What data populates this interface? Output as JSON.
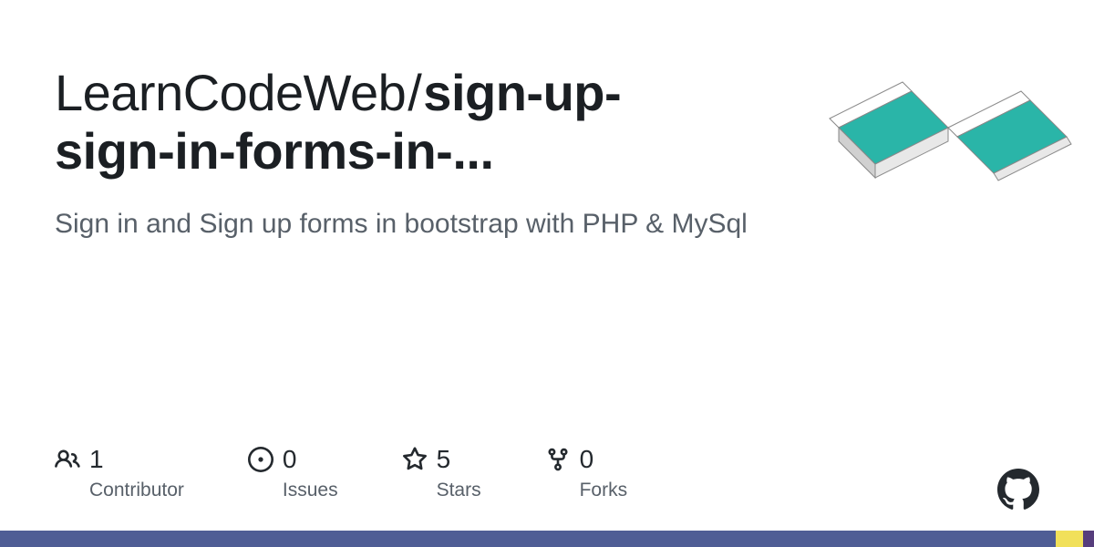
{
  "repo": {
    "owner": "LearnCodeWeb",
    "name_line1": "sign-up-",
    "name_line2": "sign-in-forms-in-...",
    "description": "Sign in and Sign up forms in bootstrap with PHP & MySql"
  },
  "stats": {
    "contributors": {
      "value": "1",
      "label": "Contributor"
    },
    "issues": {
      "value": "0",
      "label": "Issues"
    },
    "stars": {
      "value": "5",
      "label": "Stars"
    },
    "forks": {
      "value": "0",
      "label": "Forks"
    }
  },
  "colors": {
    "bar1": "#4f5d95",
    "bar2": "#f1e05a",
    "bar3": "#563d7c"
  }
}
